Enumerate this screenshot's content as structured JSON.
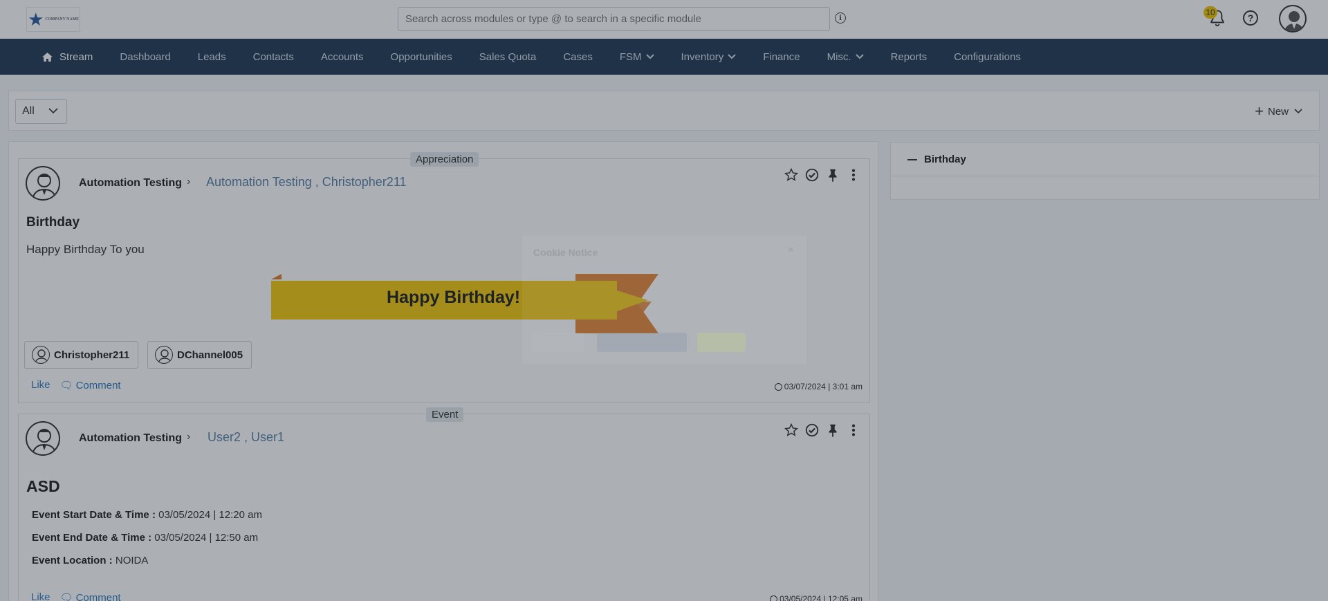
{
  "header": {
    "logo_text": "COMPANY NAME",
    "search_placeholder": "Search across modules or type @ to search in a specific module",
    "notification_count": "10"
  },
  "nav": {
    "items": [
      {
        "label": "Stream",
        "active": true
      },
      {
        "label": "Dashboard"
      },
      {
        "label": "Leads"
      },
      {
        "label": "Contacts"
      },
      {
        "label": "Accounts"
      },
      {
        "label": "Opportunities"
      },
      {
        "label": "Sales Quota"
      },
      {
        "label": "Cases"
      },
      {
        "label": "FSM",
        "dropdown": true
      },
      {
        "label": "Inventory",
        "dropdown": true
      },
      {
        "label": "Finance"
      },
      {
        "label": "Misc.",
        "dropdown": true
      },
      {
        "label": "Reports"
      },
      {
        "label": "Configurations"
      }
    ]
  },
  "filter": {
    "selected": "All",
    "new_label": "New"
  },
  "posts": [
    {
      "tag": "Appreciation",
      "author": "Automation Testing",
      "recipients": "Automation Testing , Christopher211",
      "title": "Birthday",
      "body": "Happy Birthday To you",
      "banner": "Happy Birthday!",
      "mentions": [
        "Christopher211",
        "DChannel005"
      ],
      "like": "Like",
      "comment": "Comment",
      "timestamp": "03/07/2024 | 3:01 am"
    },
    {
      "tag": "Event",
      "author": "Automation Testing",
      "recipients": "User2 , User1",
      "title": "ASD",
      "details": [
        {
          "label": "Event Start Date & Time :",
          "value": "03/05/2024 | 12:20 am"
        },
        {
          "label": "Event End Date & Time :",
          "value": "03/05/2024 | 12:50 am"
        },
        {
          "label": "Event Location :",
          "value": "NOIDA"
        }
      ],
      "like": "Like",
      "comment": "Comment",
      "timestamp": "03/05/2024 | 12:05 am"
    }
  ],
  "right_panel": {
    "title": "Birthday"
  },
  "cookie_notice": {
    "title": "Cookie Notice"
  },
  "colors": {
    "nav_bg": "#243b53",
    "link": "#2f7abf",
    "banner_yellow": "#f2c80f",
    "banner_orange": "#e07d2a"
  }
}
